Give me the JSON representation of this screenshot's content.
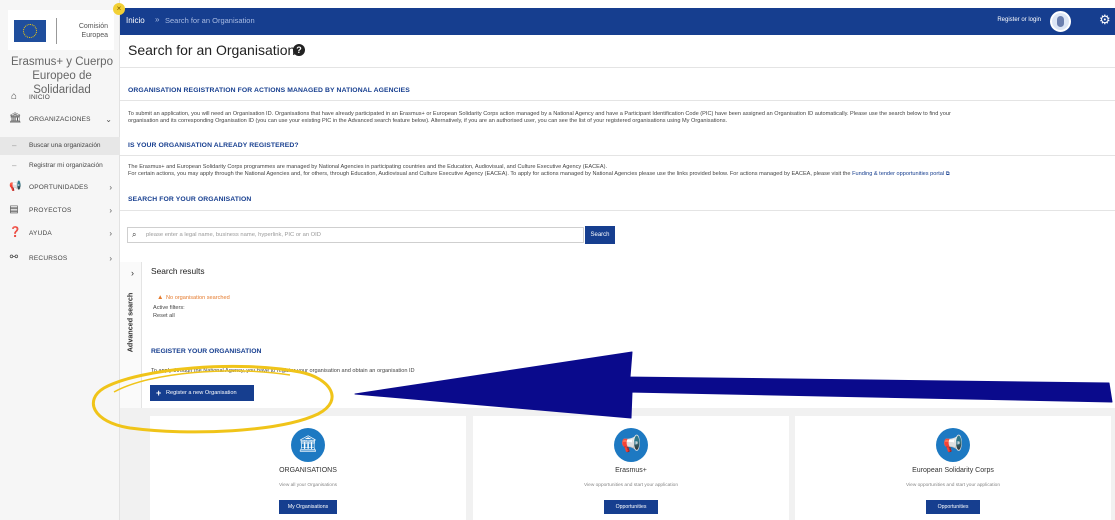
{
  "sidebar": {
    "org_name": "Comisión Europea",
    "app_title": "Erasmus+ y Cuerpo Europeo de Solidaridad",
    "items": [
      {
        "label": "INICIO",
        "icon": "home-icon",
        "has_chevron": false
      },
      {
        "label": "ORGANIZACIONES",
        "icon": "institution-icon",
        "has_chevron": true
      },
      {
        "label": "OPORTUNIDADES",
        "icon": "megaphone-icon",
        "has_chevron": true
      },
      {
        "label": "PROYECTOS",
        "icon": "projects-icon",
        "has_chevron": true
      },
      {
        "label": "AYUDA",
        "icon": "help-icon",
        "has_chevron": true
      },
      {
        "label": "RECURSOS",
        "icon": "resources-icon",
        "has_chevron": true
      }
    ],
    "subitems": [
      {
        "label": "Buscar una organización",
        "active": true
      },
      {
        "label": "Registrar mi organización",
        "active": false
      }
    ]
  },
  "topbar": {
    "home": "Inicio",
    "separator": "»",
    "current": "Search for an Organisation",
    "register_login": "Register or login"
  },
  "main": {
    "title": "Search for an Organisation",
    "section1_head": "ORGANISATION REGISTRATION FOR ACTIONS MANAGED BY NATIONAL AGENCIES",
    "section1_text_1": "To submit an application, you will need an Organisation ID. Organisations that have already participated in an Erasmus+ or European Solidarity Corps action managed by a National Agency and have a Participant Identification Code (PIC) have been assigned an Organisation ID automatically. Please use the search below to find your",
    "section1_text_2": "organisation and its corresponding Organisation ID (you can use your existing PIC in the Advanced search feature below). Alternatively, if you are an authorised user, you can see the list of your registered organisations using My Organisations.",
    "section2_head": "IS YOUR ORGANISATION ALREADY REGISTERED?",
    "section2_text_1": "The Erasmus+ and European Solidarity Corps programmes are managed by National Agencies in participating countries and the Education, Audiovisual, and Culture Executive Agency (EACEA).",
    "section2_text_2": "For certain actions, you may apply through the National Agencies and, for others, through Education, Audiovisual and Culture Executive Agency (EACEA). To apply for actions managed by National Agencies please use the links provided below. For actions managed by EACEA, please visit the",
    "section2_link": "Funding & tender opportunities portal",
    "section3_head": "SEARCH FOR YOUR ORGANISATION",
    "search_placeholder": "please enter a legal name, business name, hyperlink, PIC or an OID",
    "search_button": "Search",
    "advanced_search": "Advanced search",
    "results_title": "Search results",
    "no_org": "No organisation searched",
    "active_filters": "Active filters:",
    "reset_all": "Reset all",
    "register_head": "REGISTER YOUR ORGANISATION",
    "register_text": "To apply through the National Agency, you have to register your organisation and obtain an organisation ID",
    "register_button": "Register a new Organisation"
  },
  "cards": [
    {
      "title": "ORGANISATIONS",
      "subtitle": "View all your Organisations",
      "button": "My Organisations",
      "icon": "institution-icon"
    },
    {
      "title": "Erasmus+",
      "subtitle": "View opportunities and start your application",
      "button": "Opportunities",
      "icon": "megaphone-icon"
    },
    {
      "title": "European Solidarity Corps",
      "subtitle": "View opportunities and start your application",
      "button": "Opportunities",
      "icon": "megaphone-icon"
    }
  ],
  "colors": {
    "brand_blue": "#163e8f",
    "icon_blue": "#1d79c2",
    "warning": "#e57b2e",
    "annotation_arrow": "#0a0a8c",
    "annotation_ellipse": "#f0c419"
  }
}
